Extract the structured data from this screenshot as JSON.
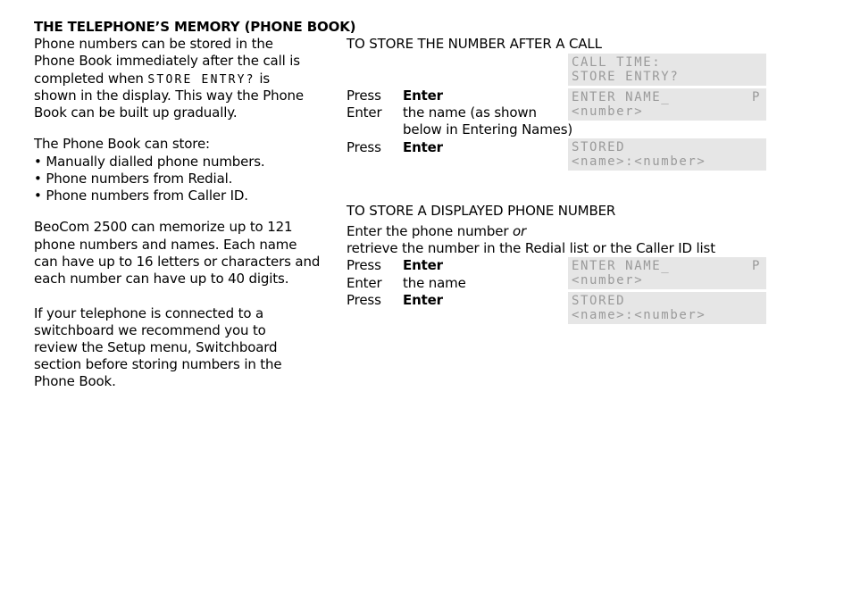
{
  "left_column": {
    "heading": "THE TELEPHONE’S MEMORY (PHONE BOOK)",
    "intro_lines": [
      "Phone numbers can be stored in the",
      "Phone Book immediately after the call is"
    ],
    "intro_line3_prefix": "completed when ",
    "intro_line3_display": "STORE ENTRY?",
    "intro_line3_suffix": " is",
    "intro_tail_lines": [
      "shown in the display. This way the Phone",
      "Book can be built up gradually."
    ],
    "store_heading": "The Phone Book can store:",
    "store_items": [
      "• Manually dialled phone numbers.",
      "• Phone numbers from Redial.",
      "• Phone numbers from Caller ID."
    ],
    "capacity_lines": [
      "BeoCom 2500 can memorize up to 121",
      "phone numbers and names. Each name",
      "can have up to 16 letters or characters and",
      "each number can have up to 40 digits."
    ],
    "switchboard_lines": [
      "If your telephone is connected to a",
      "switchboard we recommend you to",
      "review the Setup menu, Switchboard",
      "section before storing numbers in the",
      "Phone Book."
    ]
  },
  "section_after_call": {
    "heading": "TO STORE THE NUMBER AFTER A CALL",
    "steps": [
      {
        "action": "Press",
        "detail": "Enter",
        "bold": true
      },
      {
        "action": "Enter",
        "detail": "the name (as shown",
        "bold": false
      },
      {
        "action": "",
        "detail": "below in Entering Names)",
        "bold": false
      },
      {
        "action": "Press",
        "detail": "Enter",
        "bold": true
      }
    ],
    "displays": [
      {
        "line1": "CALL TIME:",
        "line2": "STORE ENTRY?",
        "right": ""
      },
      {
        "line1": "ENTER NAME_",
        "line2": "<number>",
        "right": "P"
      },
      {
        "line1": "STORED",
        "line2": "<name>:<number>",
        "right": ""
      }
    ]
  },
  "section_displayed": {
    "heading": "TO STORE A DISPLAYED PHONE NUMBER",
    "intro_line1_prefix": "Enter the phone number ",
    "intro_line1_italic": "or",
    "intro_line2": "retrieve the number in the Redial list or the Caller ID list",
    "steps": [
      {
        "action": "Press",
        "detail": "Enter",
        "bold": true
      },
      {
        "action": "Enter",
        "detail": "the name",
        "bold": false
      },
      {
        "action": "Press",
        "detail": "Enter",
        "bold": true
      }
    ],
    "displays": [
      {
        "line1": "ENTER NAME_",
        "line2": "<number>",
        "right": "P"
      },
      {
        "line1": "STORED",
        "line2": "<name>:<number>",
        "right": ""
      }
    ]
  }
}
